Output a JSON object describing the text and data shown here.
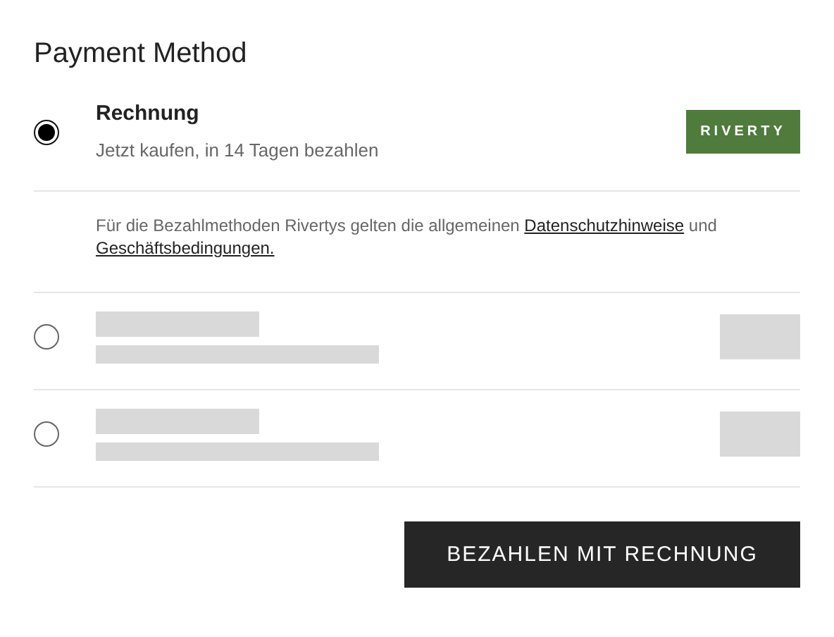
{
  "title": "Payment Method",
  "methods": [
    {
      "kind": "method",
      "selected": true,
      "label": "Rechnung",
      "subtitle": "Jetzt kaufen, in 14 Tagen bezahlen",
      "logo": "RIVERTY",
      "notice": {
        "text": "Für die Bezahlmethoden Rivertys gelten die allgemeinen ",
        "link1": "Datenschutzhinweise",
        "middle": " und ",
        "link2": "Geschäftsbedingungen."
      }
    },
    {
      "kind": "skeleton",
      "selected": false
    },
    {
      "kind": "skeleton",
      "selected": false
    }
  ],
  "submit": "BEZAHLEN MIT RECHNUNG"
}
